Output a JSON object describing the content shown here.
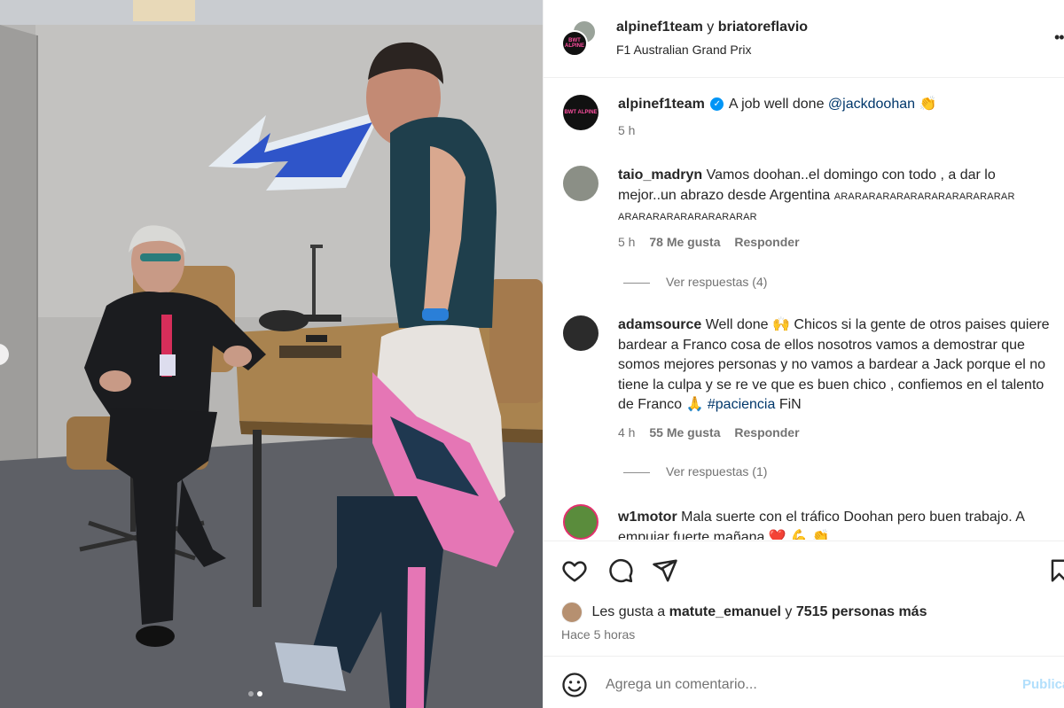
{
  "header": {
    "user1": "alpinef1team",
    "joiner": "y",
    "user2": "briatoreflavio",
    "location": "F1 Australian Grand Prix",
    "more_icon": "more-options-icon",
    "logo_text": "BWT ALPINE"
  },
  "comments": [
    {
      "user": "alpinef1team",
      "verified": true,
      "text": "A job well done",
      "mention": "@jackdoohan",
      "emoji": "👏",
      "time": "5 h"
    },
    {
      "user": "taio_madryn",
      "text": "Vamos doohan..el domingo con todo , a dar lo mejor..un abrazo desde Argentina",
      "caps_line1": "ARARARARARARARARARARARARAR",
      "caps_line2": "ARARARARARARARARARAR",
      "time": "5 h",
      "likes": "78 Me gusta",
      "reply": "Responder",
      "view_replies": "Ver respuestas (4)"
    },
    {
      "user": "adamsource",
      "text_a": "Well done",
      "emoji_a": "🙌",
      "text_b": "Chicos si la gente de otros paises quiere bardear a Franco cosa de ellos nosotros vamos a demostrar que somos mejores personas y no vamos a bardear a Jack porque el no tiene la culpa y se re ve que es buen chico , confiemos en el talento de Franco",
      "emoji_b": "🙏",
      "hashtag": "#paciencia",
      "text_c": "FiN",
      "time": "4 h",
      "likes": "55 Me gusta",
      "reply": "Responder",
      "view_replies": "Ver respuestas (1)"
    },
    {
      "user": "w1motor",
      "text": "Mala suerte con el tráfico Doohan pero buen trabajo. A empujar fuerte mañana",
      "emoji": "❤️ 💪 👏"
    }
  ],
  "actions": {
    "like_icon": "heart-icon",
    "comment_icon": "comment-icon",
    "share_icon": "share-icon",
    "save_icon": "bookmark-icon"
  },
  "likes": {
    "prefix": "Les gusta a",
    "user": "matute_emanuel",
    "joiner": "y",
    "others": "7515 personas más"
  },
  "time_ago": "Hace 5 horas",
  "add_comment": {
    "placeholder": "Agrega un comentario...",
    "post_label": "Publicar",
    "emoji_icon": "emoji-smiley-icon"
  },
  "carousel": {
    "count": 2,
    "active": 2
  },
  "colors": {
    "link": "#00376b",
    "muted": "#737373",
    "verified": "#0095f6",
    "like_red": "#ff3040",
    "post_disabled": "#b2dffc"
  }
}
